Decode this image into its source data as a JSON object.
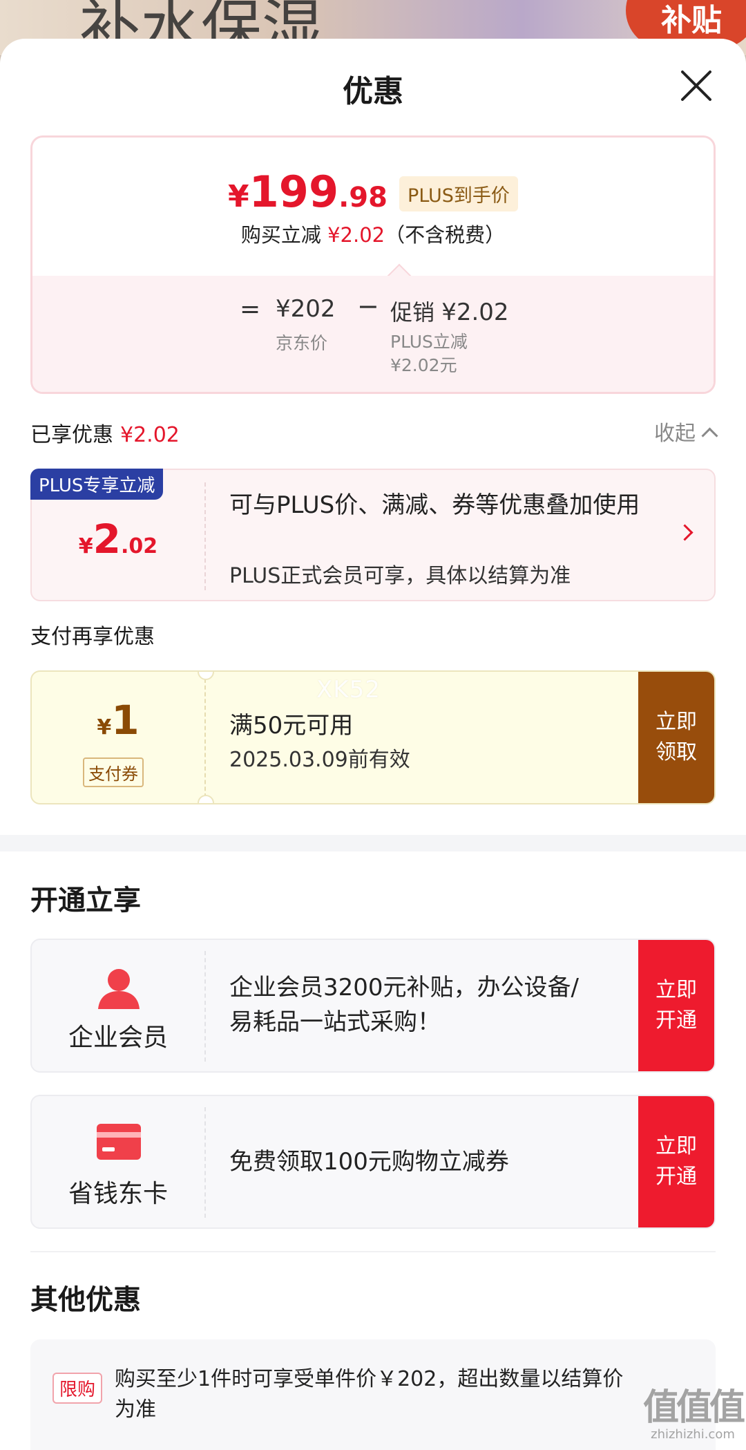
{
  "background": {
    "text": "补水保湿",
    "badge": "补贴"
  },
  "sheet": {
    "title": "优惠"
  },
  "price_card": {
    "currency": "¥",
    "price_int": "199",
    "price_dec": ".98",
    "plus_tag": "PLUS到手价",
    "reduce_prefix": "购买立减",
    "reduce_amount": "¥2.02",
    "reduce_suffix": "（不含税费）",
    "formula": {
      "eq": "=",
      "jd_price": "¥202",
      "jd_price_label": "京东价",
      "minus": "−",
      "promo_label": "促销",
      "promo_value": "¥2.02",
      "plus_label": "PLUS立减",
      "plus_value": "¥2.02元"
    }
  },
  "enjoyed": {
    "label": "已享优惠",
    "amount": "¥2.02",
    "collapse": "收起"
  },
  "plus_offer": {
    "badge": "PLUS专享立减",
    "currency": "¥",
    "amount_int": "2",
    "amount_dec": ".02",
    "desc": "可与PLUS价、满减、券等优惠叠加使用",
    "note": "PLUS正式会员可享，具体以结算为准"
  },
  "pay_section": {
    "label": "支付再享优惠"
  },
  "pay_coupon": {
    "currency": "¥",
    "amount": "1",
    "tag": "支付券",
    "condition": "满50元可用",
    "validity": "2025.03.09前有效",
    "button": "立即领取",
    "watermark": "XK52"
  },
  "open_section": {
    "title": "开通立享",
    "items": [
      {
        "name": "企业会员",
        "desc": "企业会员3200元补贴，办公设备/易耗品一站式采购！",
        "button": "立即开通",
        "icon": "person-icon"
      },
      {
        "name": "省钱东卡",
        "desc": "免费领取100元购物立减券",
        "button": "立即开通",
        "icon": "card-icon"
      }
    ]
  },
  "other_section": {
    "title": "其他优惠",
    "tag": "限购",
    "text": "购买至少1件时可享受单件价￥202，超出数量以结算价为准"
  },
  "brand": {
    "logo": "值值值",
    "url": "zhizhizhi.com"
  },
  "colors": {
    "accent_red": "#e4162b",
    "plus_blue": "#2b3fa3",
    "coupon_brown": "#984d0c",
    "open_red": "#ee1b2e"
  }
}
